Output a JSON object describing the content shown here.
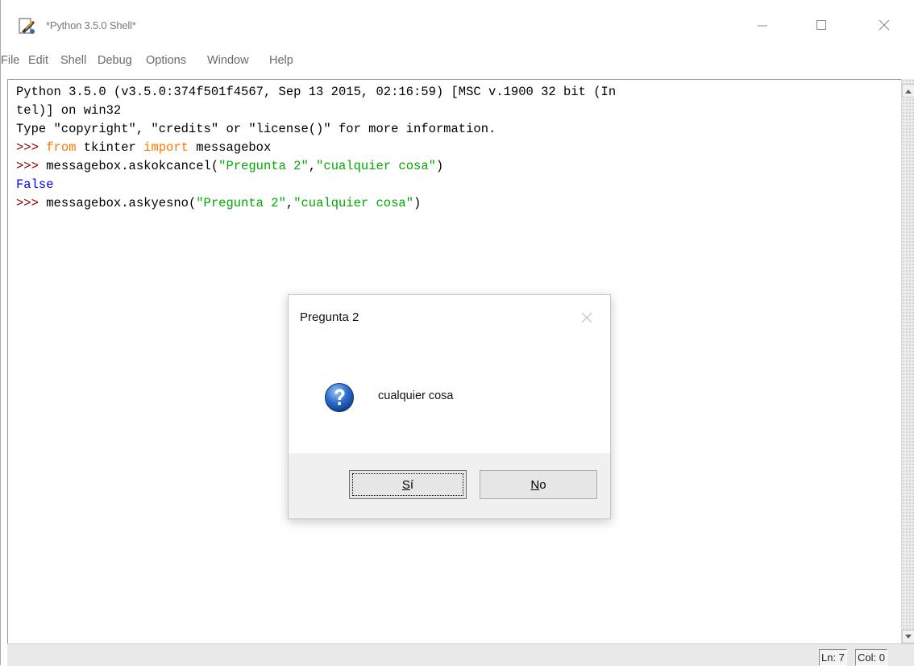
{
  "window": {
    "title": "*Python 3.5.0 Shell*",
    "icon": "idle-feather-icon"
  },
  "menu": [
    "File",
    "Edit",
    "Shell",
    "Debug",
    "Options",
    "Window",
    "Help"
  ],
  "shell": {
    "banner_line1": "Python 3.5.0 (v3.5.0:374f501f4567, Sep 13 2015, 02:16:59) [MSC v.1900 32 bit (In",
    "banner_line2": "tel)] on win32",
    "banner_line3": "Type \"copyright\", \"credits\" or \"license()\" for more information.",
    "prompt": ">>> ",
    "cmd1_kw1": "from",
    "cmd1_mid": " tkinter ",
    "cmd1_kw2": "import",
    "cmd1_end": " messagebox",
    "cmd2_pre": "messagebox.askokcancel(",
    "cmd2_str1": "\"Pregunta 2\"",
    "comma": ",",
    "cmd2_str2": "\"cualquier cosa\"",
    "close_paren": ")",
    "output1": "False",
    "cmd3_pre": "messagebox.askyesno("
  },
  "status": {
    "ln": "Ln: 7",
    "col": "Col: 0"
  },
  "dialog": {
    "title": "Pregunta 2",
    "message": "cualquier cosa",
    "icon": "question-icon",
    "yes_key": "S",
    "yes_rest": "í",
    "no_key": "N",
    "no_rest": "o"
  },
  "colors": {
    "prompt": "#8b0000",
    "keyword": "#ff7700",
    "string": "#00aa00",
    "output": "#0000ff"
  }
}
